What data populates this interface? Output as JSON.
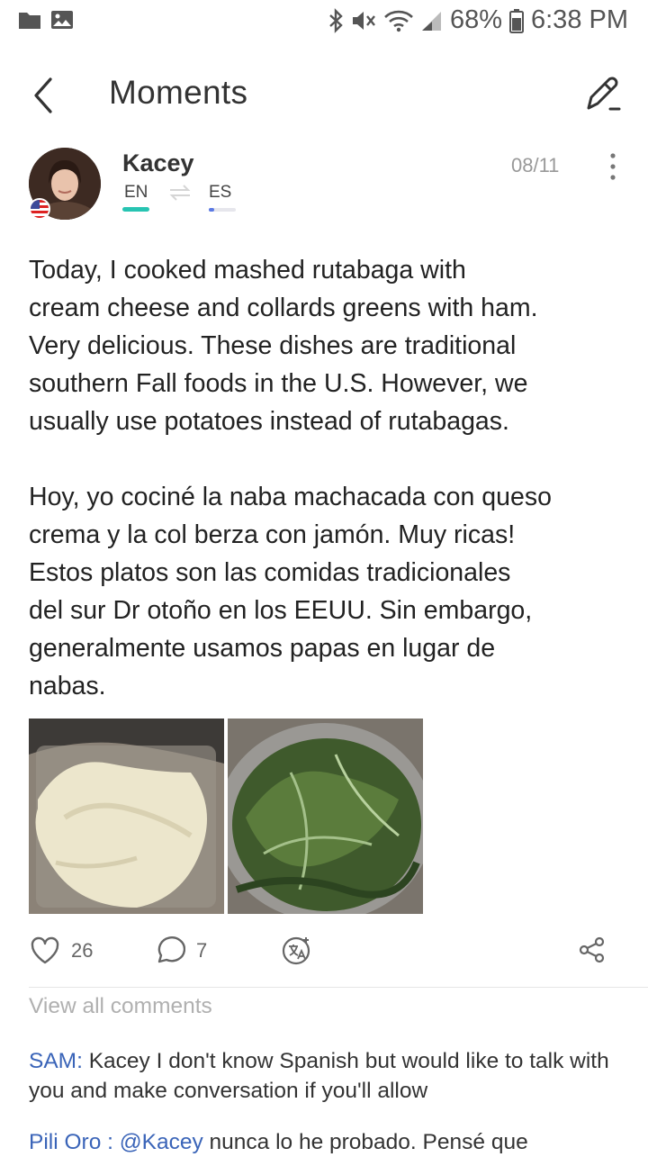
{
  "status_bar": {
    "battery": "68%",
    "time": "6:38 PM"
  },
  "header": {
    "title": "Moments"
  },
  "post": {
    "author": "Kacey",
    "native_lang": "EN",
    "learning_lang": "ES",
    "learning_progress": 0.2,
    "date": "08/11",
    "text_en": "Today, I cooked mashed rutabaga with\ncream cheese and collards greens with ham.\nVery delicious. These dishes are traditional\nsouthern Fall foods in the U.S. However, we\nusually use potatoes instead of rutabagas.",
    "text_es": "Hoy, yo cociné la naba machacada con queso\ncrema y la col berza con jamón. Muy ricas!\nEstos platos son las comidas tradicionales\ndel sur Dr otoño en los EEUU. Sin embargo,\ngeneralmente usamos papas en lugar de\nnabas.",
    "likes": "26",
    "comments": "7"
  },
  "comments": {
    "view_all": "View all comments",
    "items": [
      {
        "author": "SAM",
        "sep": ":",
        "text": " Kacey I don't know Spanish but would like to talk with you and make conversation if you'll allow"
      },
      {
        "author": "Pili Oro",
        "sep": " : ",
        "mention": "@Kacey",
        "text": " nunca lo he probado. Pensé que"
      }
    ]
  },
  "colors": {
    "accent_teal": "#27c4b2",
    "accent_blue": "#5b79e4",
    "link_blue": "#3a64b8"
  }
}
